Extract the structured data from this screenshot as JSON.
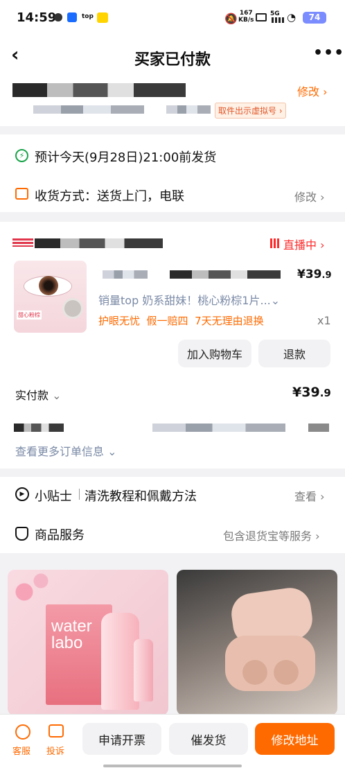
{
  "status_bar": {
    "time": "14:59",
    "speed": "167",
    "speed_unit": "KB/s",
    "net": "5G",
    "battery": "74"
  },
  "header": {
    "title": "买家已付款"
  },
  "address": {
    "modify": "修改",
    "virtual_number": "取件出示虚拟号"
  },
  "shipping": {
    "eta": "预计今天(9月28日)21:00前发货",
    "method": "收货方式：送货上门，电联",
    "modify": "修改"
  },
  "shop": {
    "live": "直播中"
  },
  "product": {
    "price_symbol": "¥",
    "price_int": "39",
    "price_dec": ".9",
    "name": "销量top 奶系甜妹！桃心粉棕1片...",
    "tags": "护眼无忧  假一赔四  7天无理由退换",
    "qty": "x1",
    "thumb_tag": "甜心粉棕",
    "btn_cart": "加入购物车",
    "btn_refund": "退款"
  },
  "payment": {
    "label": "实付款",
    "symbol": "¥",
    "int": "39",
    "dec": ".9"
  },
  "order_more": "查看更多订单信息",
  "tips": {
    "title": "小贴士",
    "desc": "清洗教程和佩戴方法",
    "action": "查看"
  },
  "service": {
    "title": "商品服务",
    "desc": "包含退货宝等服务"
  },
  "recommend": {
    "brand_line1": "water",
    "brand_line2": "labo"
  },
  "bottom": {
    "cs": "客服",
    "complain": "投诉",
    "invoice": "申请开票",
    "urge": "催发货",
    "change_addr": "修改地址"
  },
  "colors": {
    "orange": "#ff6a00",
    "red": "#ff2a2a",
    "green": "#1aa34a"
  }
}
